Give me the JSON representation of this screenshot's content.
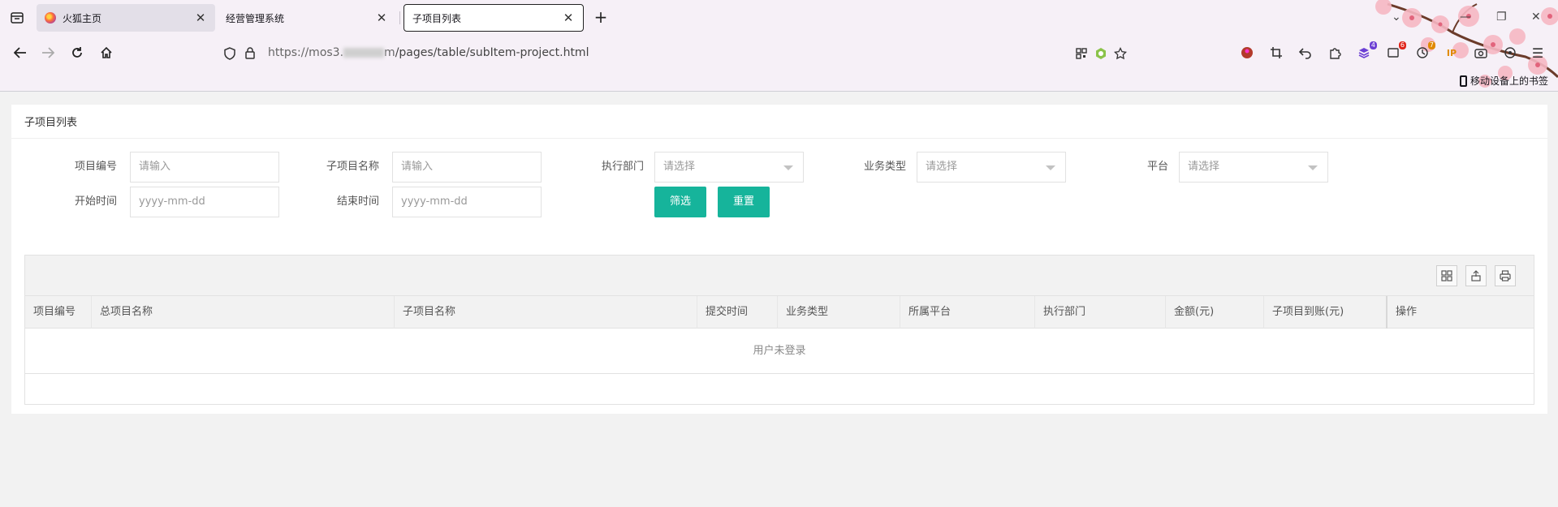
{
  "browser": {
    "tabs": [
      {
        "label": "火狐主页"
      },
      {
        "label": "经营管理系统"
      },
      {
        "label": "子项目列表"
      }
    ],
    "url": {
      "prefix": "https://mos3.",
      "suffix": "m",
      "path": "/pages/table/subItem-project.html"
    },
    "extensions": {
      "badge1": "4",
      "badge2": "6",
      "badge3": "7",
      "ip_label": "IP"
    },
    "mobile_bookmarks": "移动设备上的书签"
  },
  "page": {
    "title": "子项目列表",
    "filters": {
      "project_no": {
        "label": "项目编号",
        "placeholder": "请输入"
      },
      "sub_project_name": {
        "label": "子项目名称",
        "placeholder": "请输入"
      },
      "exec_dept": {
        "label": "执行部门",
        "placeholder": "请选择"
      },
      "business_type": {
        "label": "业务类型",
        "placeholder": "请选择"
      },
      "platform": {
        "label": "平台",
        "placeholder": "请选择"
      },
      "start_time": {
        "label": "开始时间",
        "placeholder": "yyyy-mm-dd"
      },
      "end_time": {
        "label": "结束时间",
        "placeholder": "yyyy-mm-dd"
      }
    },
    "buttons": {
      "filter": "筛选",
      "reset": "重置"
    },
    "table": {
      "columns": [
        "项目编号",
        "总项目名称",
        "子项目名称",
        "提交时间",
        "业务类型",
        "所属平台",
        "执行部门",
        "金额(元)",
        "子项目到账(元)",
        "操作"
      ],
      "empty_text": "用户未登录"
    }
  },
  "colors": {
    "accent": "#16b49b"
  }
}
